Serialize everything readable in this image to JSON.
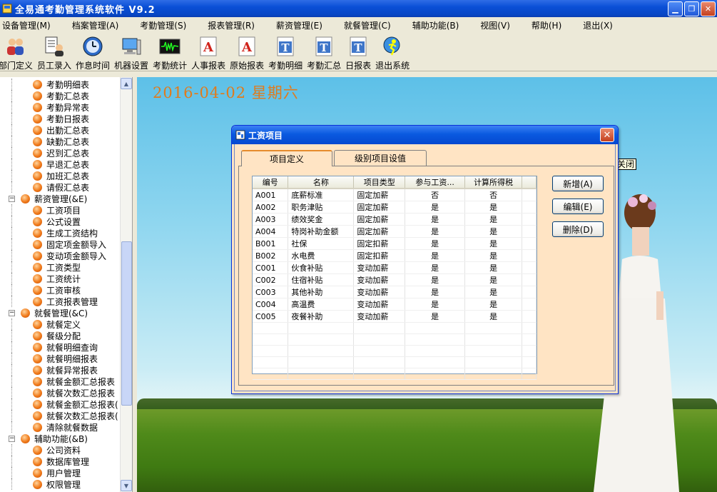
{
  "window": {
    "title": "全易通考勤管理系统软件 V9.2"
  },
  "menu": [
    "设备管理(M)",
    "档案管理(A)",
    "考勤管理(S)",
    "报表管理(R)",
    "薪资管理(E)",
    "就餐管理(C)",
    "辅助功能(B)",
    "视图(V)",
    "帮助(H)",
    "退出(X)"
  ],
  "toolbar": [
    {
      "label": "部门定义",
      "icon": "users-icon"
    },
    {
      "label": "员工录入",
      "icon": "employee-icon"
    },
    {
      "label": "作息时间",
      "icon": "clock-icon"
    },
    {
      "label": "机器设置",
      "icon": "computer-icon"
    },
    {
      "label": "考勤统计",
      "icon": "waveform-icon"
    },
    {
      "label": "人事报表",
      "icon": "report-a-icon"
    },
    {
      "label": "原始报表",
      "icon": "report-a-icon"
    },
    {
      "label": "考勤明细",
      "icon": "report-t-icon"
    },
    {
      "label": "考勤汇总",
      "icon": "report-t-icon"
    },
    {
      "label": "日报表",
      "icon": "report-t-icon"
    },
    {
      "label": "退出系统",
      "icon": "exit-icon"
    }
  ],
  "tree": [
    {
      "type": "child",
      "label": "考勤明细表"
    },
    {
      "type": "child",
      "label": "考勤汇总表"
    },
    {
      "type": "child",
      "label": "考勤异常表"
    },
    {
      "type": "child",
      "label": "考勤日报表"
    },
    {
      "type": "child",
      "label": "出勤汇总表"
    },
    {
      "type": "child",
      "label": "缺勤汇总表"
    },
    {
      "type": "child",
      "label": "迟到汇总表"
    },
    {
      "type": "child",
      "label": "早退汇总表"
    },
    {
      "type": "child",
      "label": "加班汇总表"
    },
    {
      "type": "child",
      "label": "请假汇总表"
    },
    {
      "type": "parent",
      "label": "薪资管理(&E)"
    },
    {
      "type": "child",
      "label": "工资项目"
    },
    {
      "type": "child",
      "label": "公式设置"
    },
    {
      "type": "child",
      "label": "生成工资结构"
    },
    {
      "type": "child",
      "label": "固定项金额导入"
    },
    {
      "type": "child",
      "label": "变动项金额导入"
    },
    {
      "type": "child",
      "label": "工资类型"
    },
    {
      "type": "child",
      "label": "工资统计"
    },
    {
      "type": "child",
      "label": "工资审核"
    },
    {
      "type": "child",
      "label": "工资报表管理"
    },
    {
      "type": "parent",
      "label": "就餐管理(&C)"
    },
    {
      "type": "child",
      "label": "就餐定义"
    },
    {
      "type": "child",
      "label": "餐级分配"
    },
    {
      "type": "child",
      "label": "就餐明细查询"
    },
    {
      "type": "child",
      "label": "就餐明细报表"
    },
    {
      "type": "child",
      "label": "就餐异常报表"
    },
    {
      "type": "child",
      "label": "就餐金额汇总报表"
    },
    {
      "type": "child",
      "label": "就餐次数汇总报表"
    },
    {
      "type": "child",
      "label": "就餐金额汇总报表("
    },
    {
      "type": "child",
      "label": "就餐次数汇总报表("
    },
    {
      "type": "child",
      "label": "清除就餐数据"
    },
    {
      "type": "parent",
      "label": "辅助功能(&B)"
    },
    {
      "type": "child",
      "label": "公司资料"
    },
    {
      "type": "child",
      "label": "数据库管理"
    },
    {
      "type": "child",
      "label": "用户管理"
    },
    {
      "type": "child",
      "label": "权限管理"
    }
  ],
  "desktop": {
    "date": "2016-04-02 星期六",
    "tooltip": "关闭"
  },
  "dialog": {
    "title": "工资项目",
    "close": "✕",
    "tabs": [
      "项目定义",
      "级别项目设值"
    ],
    "columns": [
      "编号",
      "名称",
      "项目类型",
      "参与工资...",
      "计算所得税"
    ],
    "rows": [
      [
        "A001",
        "底薪标准",
        "固定加薪",
        "否",
        "否"
      ],
      [
        "A002",
        "职务津贴",
        "固定加薪",
        "是",
        "是"
      ],
      [
        "A003",
        "绩效奖金",
        "固定加薪",
        "是",
        "是"
      ],
      [
        "A004",
        "特岗补助金额",
        "固定加薪",
        "是",
        "是"
      ],
      [
        "B001",
        "社保",
        "固定扣薪",
        "是",
        "是"
      ],
      [
        "B002",
        "水电费",
        "固定扣薪",
        "是",
        "是"
      ],
      [
        "C001",
        "伙食补贴",
        "变动加薪",
        "是",
        "是"
      ],
      [
        "C002",
        "住宿补贴",
        "变动加薪",
        "是",
        "是"
      ],
      [
        "C003",
        "其他补助",
        "变动加薪",
        "是",
        "是"
      ],
      [
        "C004",
        "高温费",
        "变动加薪",
        "是",
        "是"
      ],
      [
        "C005",
        "夜餐补助",
        "变动加薪",
        "是",
        "是"
      ]
    ],
    "buttons": {
      "add": "新增(A)",
      "edit": "编辑(E)",
      "delete": "删除(D)"
    }
  }
}
